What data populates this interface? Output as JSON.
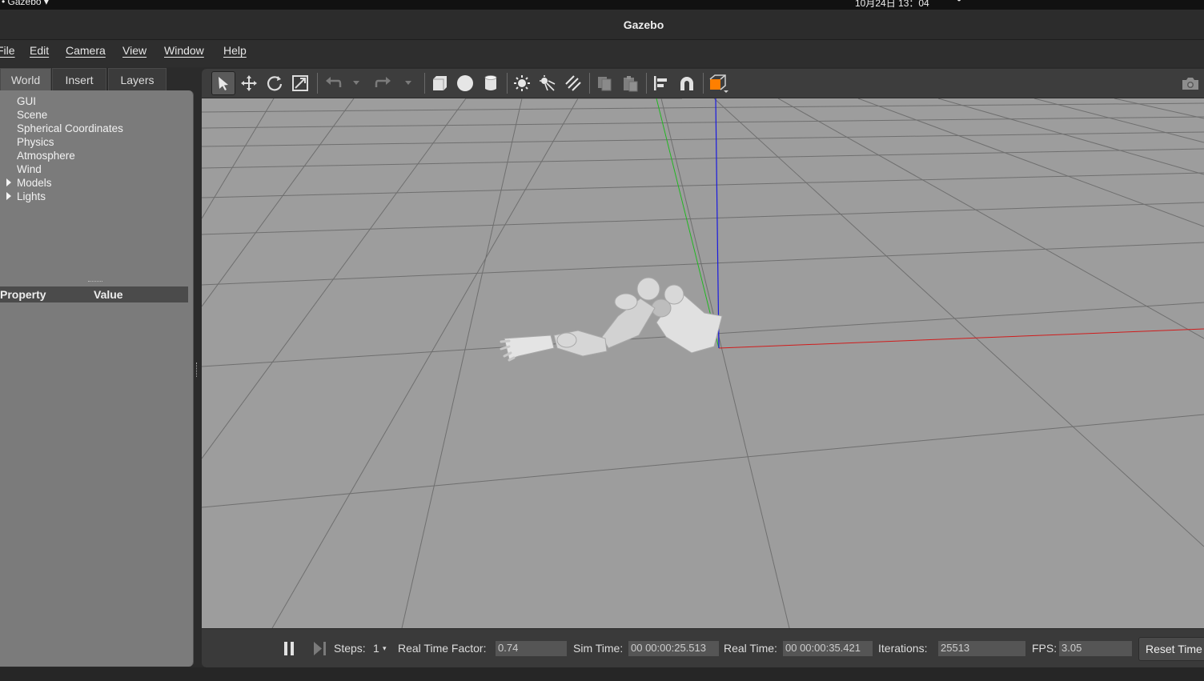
{
  "system_bar": {
    "app": "• Gazebo ▾",
    "clock": "10月24日 13：04"
  },
  "window": {
    "title": "Gazebo"
  },
  "menu": [
    "File",
    "Edit",
    "Camera",
    "View",
    "Window",
    "Help"
  ],
  "left_panel": {
    "tabs": [
      "World",
      "Insert",
      "Layers"
    ],
    "active_tab": "World",
    "tree": [
      {
        "label": "GUI",
        "expandable": false
      },
      {
        "label": "Scene",
        "expandable": false
      },
      {
        "label": "Spherical Coordinates",
        "expandable": false
      },
      {
        "label": "Physics",
        "expandable": false
      },
      {
        "label": "Atmosphere",
        "expandable": false
      },
      {
        "label": "Wind",
        "expandable": false
      },
      {
        "label": "Models",
        "expandable": true
      },
      {
        "label": "Lights",
        "expandable": true
      }
    ],
    "property_header": {
      "property": "Property",
      "value": "Value"
    }
  },
  "toolbar": {
    "tools": [
      "select-mode",
      "translate-mode",
      "rotate-mode",
      "scale-mode",
      "undo",
      "redo",
      "box-shape",
      "sphere-shape",
      "cylinder-shape",
      "point-light",
      "spot-light",
      "directional-light",
      "copy",
      "paste",
      "align",
      "snap",
      "view-angle",
      "screenshot"
    ]
  },
  "colors": {
    "x_axis": "#d01c1c",
    "y_axis": "#1fb81f",
    "z_axis": "#1a1ae0",
    "accent": "#ff7f00"
  },
  "status": {
    "steps_label": "Steps:",
    "steps_value": "1",
    "rtf_label": "Real Time Factor:",
    "rtf_value": "0.74",
    "sim_time_label": "Sim Time:",
    "sim_time_value": "00 00:00:25.513",
    "real_time_label": "Real Time:",
    "real_time_value": "00 00:00:35.421",
    "iterations_label": "Iterations:",
    "iterations_value": "25513",
    "fps_label": "FPS:",
    "fps_value": "3.05",
    "reset_label": "Reset Time"
  }
}
